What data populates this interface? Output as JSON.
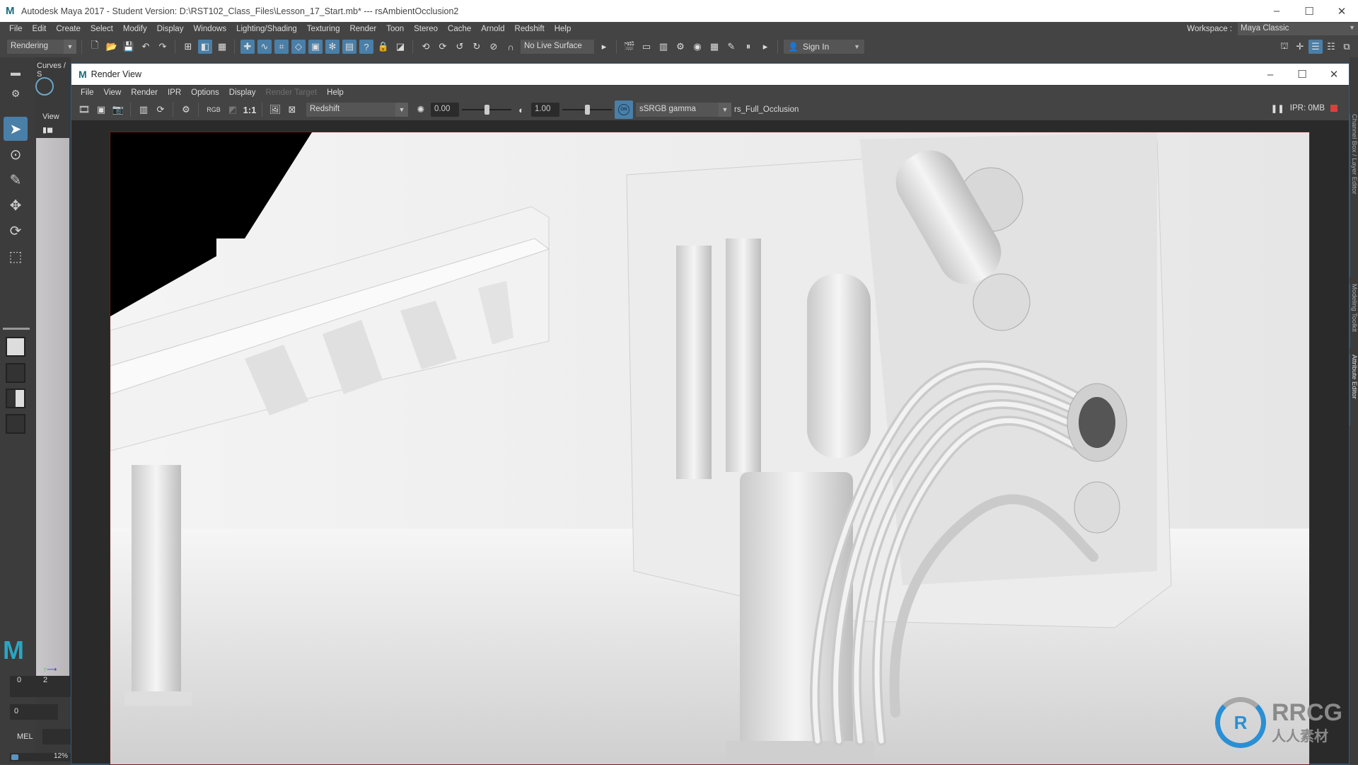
{
  "app": {
    "logo": "M",
    "title": "Autodesk Maya 2017 - Student Version: D:\\RST102_Class_Files\\Lesson_17_Start.mb*   ---   rsAmbientOcclusion2",
    "window_controls": {
      "minimize": "–",
      "maximize": "☐",
      "close": "✕"
    }
  },
  "menubar": [
    "File",
    "Edit",
    "Create",
    "Select",
    "Modify",
    "Display",
    "Windows",
    "Lighting/Shading",
    "Texturing",
    "Render",
    "Toon",
    "Stereo",
    "Cache",
    "Arnold",
    "Redshift",
    "Help"
  ],
  "workspace": {
    "label": "Workspace :",
    "value": "Maya Classic"
  },
  "status_line": {
    "menu_set": "Rendering",
    "live_surface": "No Live Surface",
    "sign_in": "Sign In"
  },
  "left_panel": {
    "shelf_tab": "Curves / S",
    "view_label": "View",
    "tools": [
      "select-tool",
      "lasso-tool",
      "paint-select-tool",
      "move-tool",
      "rotate-tool",
      "scale-tool"
    ],
    "timeslider": {
      "ticks": [
        "0",
        "2"
      ]
    },
    "current_frame": "0",
    "script_lang": "MEL",
    "progress_text": "12%",
    "progress_value": 0.12
  },
  "render_view": {
    "title": "Render View",
    "logo": "M",
    "menus": [
      {
        "label": "File",
        "enabled": true
      },
      {
        "label": "View",
        "enabled": true
      },
      {
        "label": "Render",
        "enabled": true
      },
      {
        "label": "IPR",
        "enabled": true
      },
      {
        "label": "Options",
        "enabled": true
      },
      {
        "label": "Display",
        "enabled": true
      },
      {
        "label": "Render Target",
        "enabled": false
      },
      {
        "label": "Help",
        "enabled": true
      }
    ],
    "toolbar": {
      "rgb_label": "RGB",
      "ratio_label": "1:1",
      "renderer": "Redshift",
      "exposure": "0.00",
      "exposure_value": 0.0,
      "gamma": "1.00",
      "gamma_value": 1.0,
      "color_mgmt_on": "ON",
      "view_transform": "sSRGB gamma",
      "aov": "rs_Full_Occlusion"
    },
    "ipr_status": "IPR: 0MB"
  },
  "right_tabs": [
    "Channel Box / Layer Editor",
    "Modeling Toolkit",
    "Attribute Editor"
  ],
  "watermark": {
    "brand": "RRCG",
    "subtitle": "人人素材"
  },
  "colors": {
    "accent": "#4a7fa8",
    "record": "#d9413c",
    "ui_bg": "#444444",
    "border_blue": "#2d5e86"
  }
}
